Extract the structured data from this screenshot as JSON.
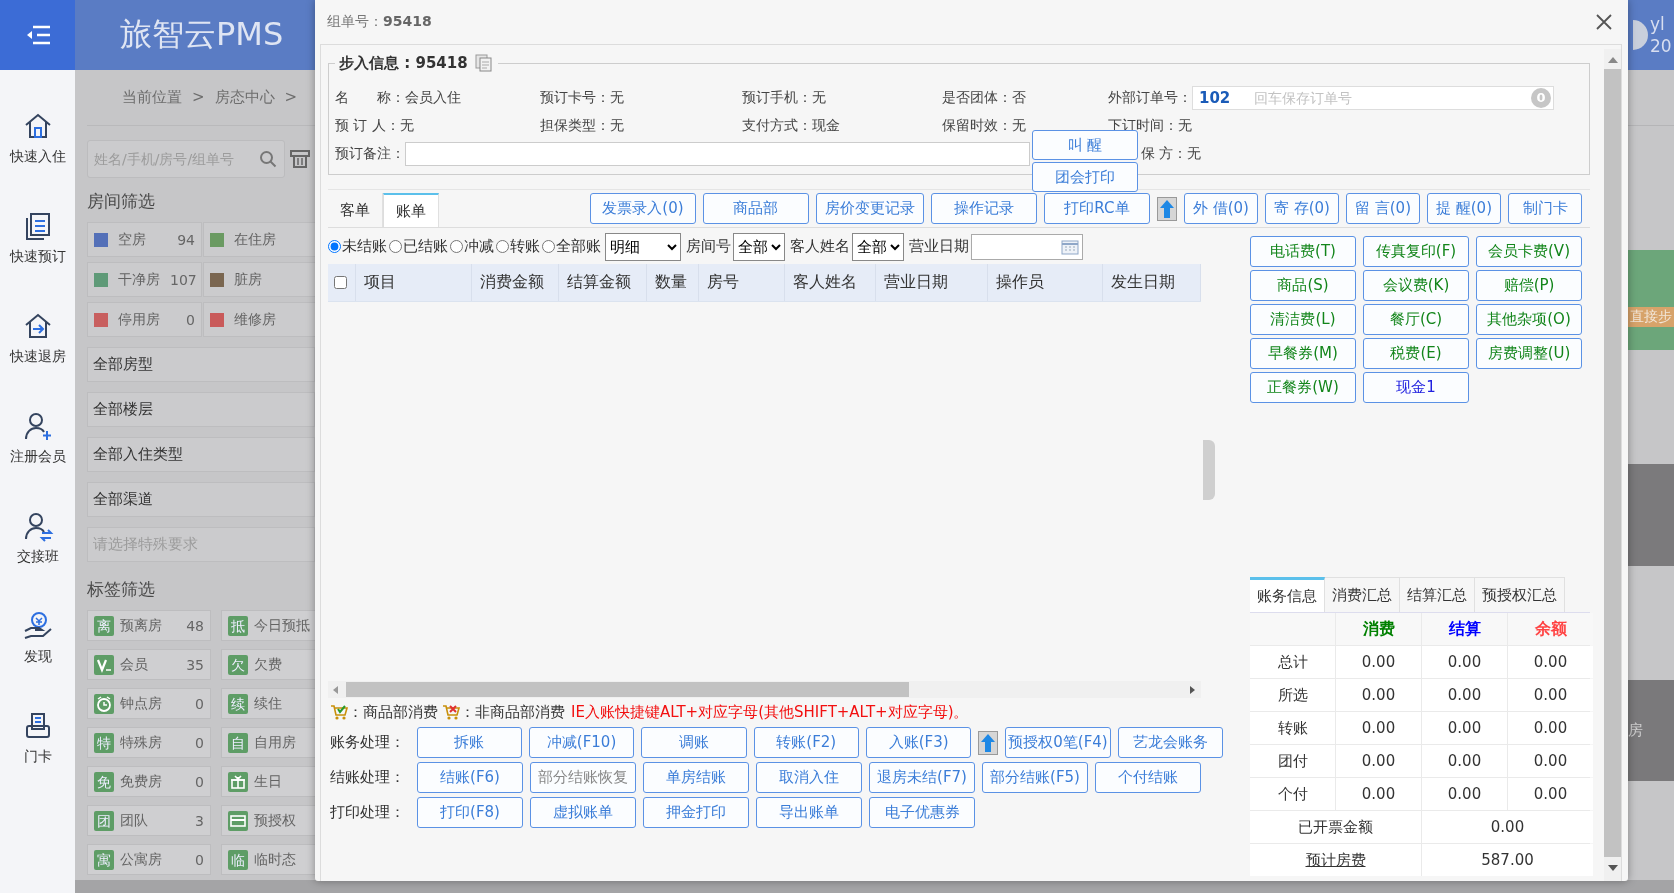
{
  "header": {
    "title": "旅智云PMS",
    "user_name": "yl",
    "user_date": "20"
  },
  "nav": [
    {
      "label": "快速入住",
      "kind": "checkin"
    },
    {
      "label": "快速预订",
      "kind": "booking"
    },
    {
      "label": "快速退房",
      "kind": "checkout"
    },
    {
      "label": "注册会员",
      "kind": "member"
    },
    {
      "label": "交接班",
      "kind": "shift"
    },
    {
      "label": "发现",
      "kind": "discover"
    },
    {
      "label": "门卡",
      "kind": "card"
    }
  ],
  "breadcrumb": [
    "当前位置",
    ">",
    "房态中心",
    ">"
  ],
  "search": {
    "placeholder": "姓名/手机/房号/组单号"
  },
  "room_filter": {
    "title": "房间筛选",
    "items": [
      {
        "label": "空房",
        "count": "94",
        "color": "#5470b8"
      },
      {
        "label": "在住房",
        "color": "#6a9a62"
      },
      {
        "label": "干净房",
        "count": "107",
        "color": "#5f9a78"
      },
      {
        "label": "脏房",
        "color": "#7a6650"
      },
      {
        "label": "停用房",
        "count": "0",
        "color": "#c85f5f"
      },
      {
        "label": "维修房",
        "color": "#c95a5a"
      }
    ]
  },
  "selects": [
    "全部房型",
    "全部楼层",
    "全部入住类型",
    "全部渠道"
  ],
  "special_requests": {
    "placeholder": "请选择特殊要求"
  },
  "tag_filter": {
    "title": "标签筛选",
    "items": [
      {
        "kind": "text",
        "badge": "离",
        "label": "预离房",
        "count": "48"
      },
      {
        "kind": "text",
        "badge": "抵",
        "label": "今日预抵"
      },
      {
        "kind": "vip",
        "label": "会员",
        "count": "35"
      },
      {
        "kind": "text",
        "badge": "欠",
        "label": "欠费"
      },
      {
        "kind": "clock",
        "label": "钟点房",
        "count": "0"
      },
      {
        "kind": "text",
        "badge": "续",
        "label": "续住"
      },
      {
        "kind": "text",
        "badge": "特",
        "label": "特殊房",
        "count": "0"
      },
      {
        "kind": "text",
        "badge": "自",
        "label": "自用房"
      },
      {
        "kind": "text",
        "badge": "免",
        "label": "免费房",
        "count": "0"
      },
      {
        "kind": "gift",
        "label": "生日"
      },
      {
        "kind": "text",
        "badge": "团",
        "label": "团队",
        "count": "3"
      },
      {
        "kind": "card",
        "label": "预授权"
      },
      {
        "kind": "text",
        "badge": "寓",
        "label": "公寓房",
        "count": "0"
      },
      {
        "kind": "text",
        "badge": "临",
        "label": "临时态"
      }
    ]
  },
  "right_strip": {
    "labels": [
      "直接步",
      "房"
    ]
  },
  "dialog": {
    "title": "组单号：**95418**",
    "section_title": "步入信息 : 95418",
    "info_rows": [
      [
        {
          "label": "名　　称：",
          "value": "会员入住"
        },
        {
          "label": "预订卡号：",
          "value": "无"
        },
        {
          "label": "预订手机：",
          "value": "无"
        },
        {
          "label": "是否团体：",
          "value": "否"
        },
        {
          "label": "外部订单号：",
          "kind": "order"
        }
      ],
      [
        {
          "label": "预 订 人：",
          "value": "无"
        },
        {
          "label": "担保类型：",
          "value": "无"
        },
        {
          "label": "支付方式：",
          "value": "现金"
        },
        {
          "label": "保留时效：",
          "value": "无"
        },
        {
          "label": "下订时间：",
          "value": "无"
        }
      ]
    ],
    "external_order": {
      "value": "102",
      "placeholder": "回车保存订单号",
      "count": "0"
    },
    "remark": {
      "label": "预订备注："
    },
    "guarantor": {
      "label": "保 方：",
      "value": "无"
    },
    "floating_buttons": [
      "叫 醒",
      "团会打印"
    ],
    "tabs": [
      {
        "label": "客单",
        "selected": false
      },
      {
        "label": "账单",
        "selected": true
      }
    ],
    "toolbar": [
      {
        "kind": "button",
        "label": "发票录入(0)"
      },
      {
        "kind": "button",
        "label": "商品部"
      },
      {
        "kind": "button",
        "label": "房价变更记录"
      },
      {
        "kind": "button",
        "label": "操作记录"
      },
      {
        "kind": "button",
        "label": "打印RC单"
      },
      {
        "kind": "arrow"
      },
      {
        "kind": "button",
        "label": "外 借(0)"
      },
      {
        "kind": "button",
        "label": "寄 存(0)"
      },
      {
        "kind": "button",
        "label": "留 言(0)"
      },
      {
        "kind": "button",
        "label": "提 醒(0)"
      },
      {
        "kind": "button",
        "label": "制门卡"
      }
    ],
    "filters": {
      "radios": [
        {
          "label": "未结账",
          "selected": true
        },
        {
          "label": "已结账",
          "selected": false
        },
        {
          "label": "冲减",
          "selected": false
        },
        {
          "label": "转账",
          "selected": false
        },
        {
          "label": "全部账",
          "selected": false
        }
      ],
      "selects": [
        {
          "value": "明细"
        },
        {
          "label": "房间号",
          "value": "全部"
        },
        {
          "label": "客人姓名",
          "value": "全部"
        }
      ],
      "date_label": "营业日期"
    },
    "table": {
      "all_checked": false,
      "columns": [
        "项目",
        "消费金额",
        "结算金额",
        "数量",
        "房号",
        "客人姓名",
        "营业日期",
        "操作员",
        "发生日期"
      ]
    },
    "legend": {
      "items": [
        {
          "kind": "store",
          "label": "：商品部消费"
        },
        {
          "kind": "other",
          "label": "：非商品部消费"
        }
      ],
      "hint": "IE入账快捷键ALT+对应字母(其他SHIFT+ALT+对应字母)。"
    },
    "actions": [
      {
        "label": "账务处理：",
        "buttons": [
          {
            "kind": "button",
            "label": "拆账",
            "disabled": false
          },
          {
            "kind": "button",
            "label": "冲减(F10)",
            "disabled": false
          },
          {
            "kind": "button",
            "label": "调账",
            "disabled": false
          },
          {
            "kind": "button",
            "label": "转账(F2)",
            "disabled": false
          },
          {
            "kind": "button",
            "label": "入账(F3)",
            "disabled": false
          },
          {
            "kind": "arrow"
          },
          {
            "kind": "button",
            "label": "预授权0笔(F4)",
            "disabled": false
          },
          {
            "kind": "button",
            "label": "艺龙会账务",
            "disabled": false
          }
        ]
      },
      {
        "label": "结账处理：",
        "buttons": [
          {
            "kind": "button",
            "label": "结账(F6)",
            "disabled": false
          },
          {
            "kind": "button",
            "label": "部分结账恢复",
            "disabled": true
          },
          {
            "kind": "button",
            "label": "单房结账",
            "disabled": false
          },
          {
            "kind": "button",
            "label": "取消入住",
            "disabled": false
          },
          {
            "kind": "button",
            "label": "退房未结(F7)",
            "disabled": false
          },
          {
            "kind": "button",
            "label": "部分结账(F5)",
            "disabled": false
          },
          {
            "kind": "button",
            "label": "个付结账",
            "disabled": false
          }
        ]
      },
      {
        "label": "打印处理：",
        "buttons": [
          {
            "kind": "button",
            "label": "打印(F8)",
            "disabled": false
          },
          {
            "kind": "button",
            "label": "虚拟账单",
            "disabled": false
          },
          {
            "kind": "button",
            "label": "押金打印",
            "disabled": false
          },
          {
            "kind": "button",
            "label": "导出账单",
            "disabled": false
          },
          {
            "kind": "button",
            "label": "电子优惠券",
            "disabled": false
          }
        ]
      }
    ],
    "charges": [
      {
        "label": "电话费(T)",
        "kind": "charge"
      },
      {
        "label": "传真复印(F)",
        "kind": "charge"
      },
      {
        "label": "会员卡费(V)",
        "kind": "charge"
      },
      {
        "label": "商品(S)",
        "kind": "charge"
      },
      {
        "label": "会议费(K)",
        "kind": "charge"
      },
      {
        "label": "赔偿(P)",
        "kind": "charge"
      },
      {
        "label": "清洁费(L)",
        "kind": "charge"
      },
      {
        "label": "餐厅(C)",
        "kind": "charge"
      },
      {
        "label": "其他杂项(O)",
        "kind": "charge"
      },
      {
        "label": "早餐券(M)",
        "kind": "charge"
      },
      {
        "label": "税费(E)",
        "kind": "charge"
      },
      {
        "label": "房费调整(U)",
        "kind": "charge"
      },
      {
        "label": "正餐券(W)",
        "kind": "charge"
      },
      {
        "label": "现金1",
        "kind": "payment"
      }
    ],
    "summary": {
      "tabs": [
        {
          "label": "账务信息",
          "selected": true
        },
        {
          "label": "消费汇总",
          "selected": false
        },
        {
          "label": "结算汇总",
          "selected": false
        },
        {
          "label": "预授权汇总",
          "selected": false
        }
      ],
      "columns": [
        {
          "label": "消费",
          "color": "#008000"
        },
        {
          "label": "结算",
          "color": "#0000ff"
        },
        {
          "label": "余额",
          "color": "#ff4444"
        }
      ],
      "rows": [
        {
          "label": "总计",
          "values": [
            "0.00",
            "0.00",
            "0.00"
          ]
        },
        {
          "label": "所选",
          "values": [
            "0.00",
            "0.00",
            "0.00"
          ]
        },
        {
          "label": "转账",
          "values": [
            "0.00",
            "0.00",
            "0.00"
          ]
        },
        {
          "label": "团付",
          "values": [
            "0.00",
            "0.00",
            "0.00"
          ]
        },
        {
          "label": "个付",
          "values": [
            "0.00",
            "0.00",
            "0.00"
          ]
        }
      ],
      "totals": [
        {
          "label": "已开票金额",
          "value": "0.00",
          "link": false
        },
        {
          "label": "预计房费",
          "value": "587.00",
          "link": true
        }
      ]
    }
  }
}
